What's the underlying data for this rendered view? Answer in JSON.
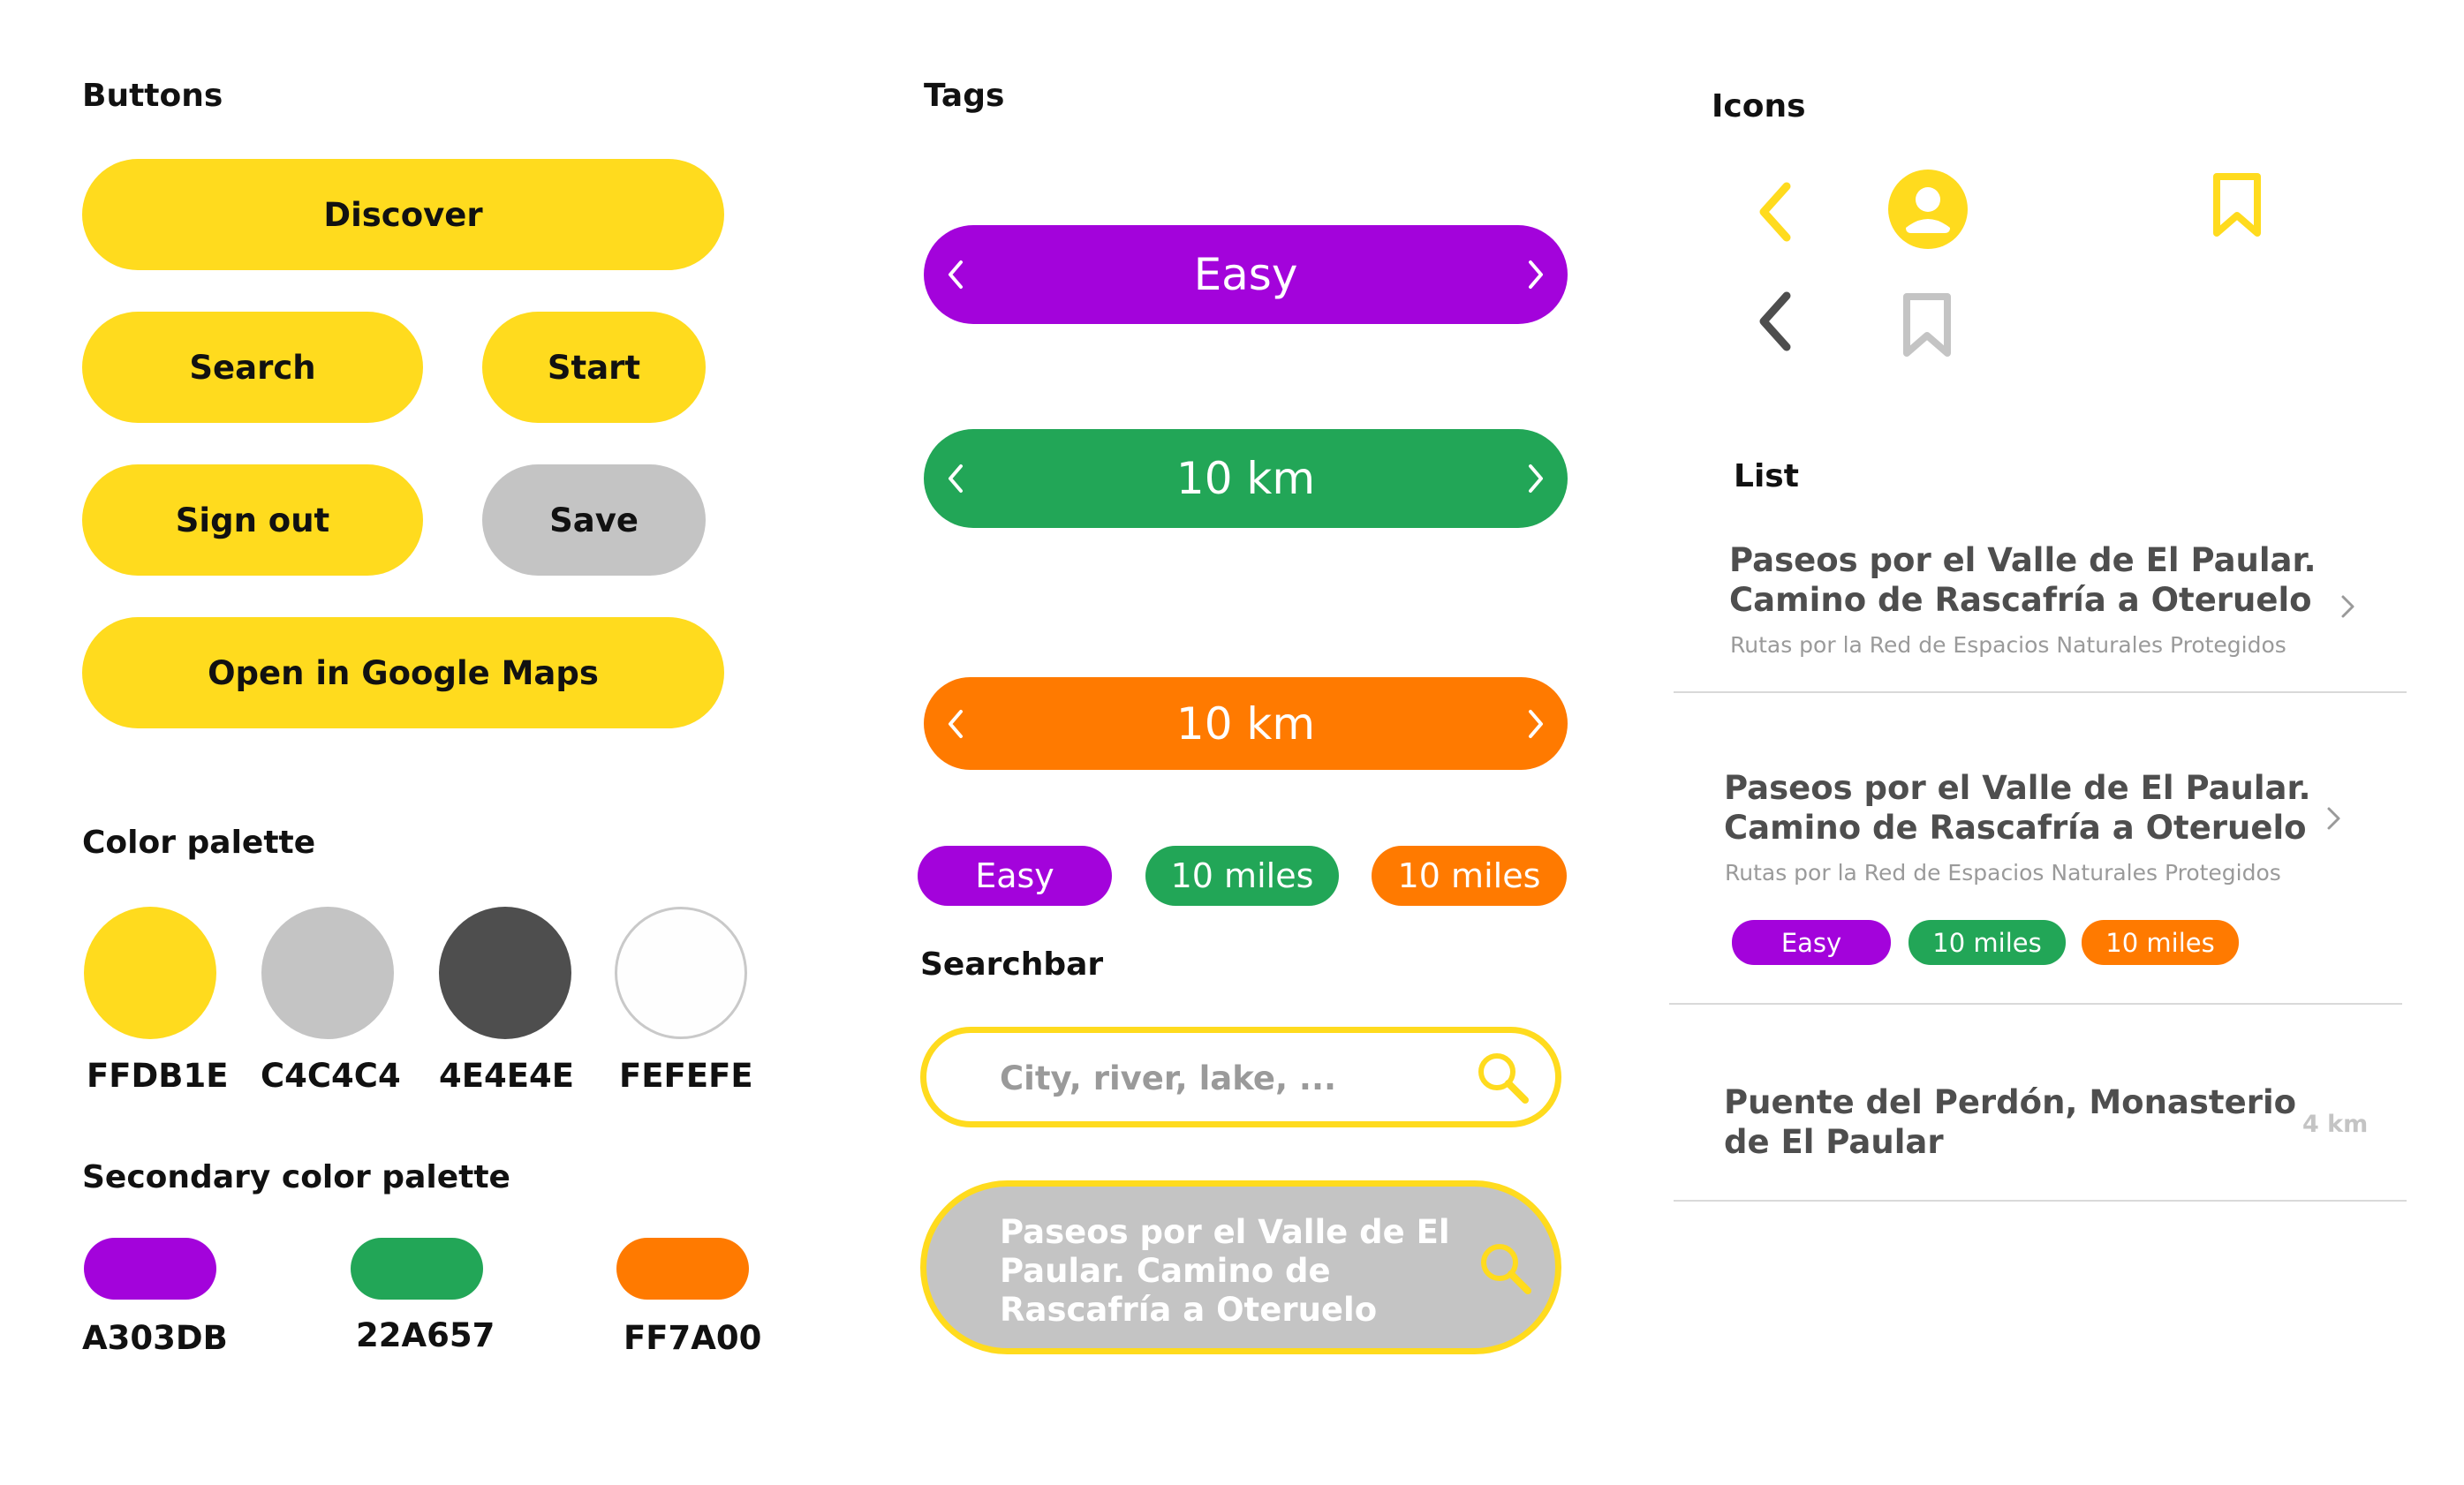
{
  "buttons": {
    "heading": "Buttons",
    "discover": "Discover",
    "search": "Search",
    "start": "Start",
    "sign_out": "Sign out",
    "save": "Save",
    "open_maps": "Open in Google Maps"
  },
  "palette": {
    "heading": "Color palette",
    "colors": [
      "FFDB1E",
      "C4C4C4",
      "4E4E4E",
      "FEFEFE"
    ]
  },
  "secondary_palette": {
    "heading": "Secondary color palette",
    "colors": [
      "A303DB",
      "22A657",
      "FF7A00"
    ]
  },
  "tags": {
    "heading": "Tags",
    "large": [
      "Easy",
      "10 km",
      "10 km"
    ],
    "small": [
      "Easy",
      "10 miles",
      "10 miles"
    ],
    "colors": {
      "purple": "#A303DB",
      "green": "#22A657",
      "orange": "#FF7A00"
    }
  },
  "searchbar": {
    "heading": "Searchbar",
    "placeholder": "City, river, lake, ...",
    "filled_line1": "Paseos por el Valle de El",
    "filled_line2": "Paular. Camino de",
    "filled_line3": "Rascafría a Oteruelo",
    "icon": "search-icon"
  },
  "icons": {
    "heading": "Icons",
    "items": [
      "chevron-left-icon",
      "user-circle-icon",
      "bookmark-icon",
      "chevron-left-icon",
      "bookmark-outline-icon"
    ]
  },
  "list": {
    "heading": "List",
    "items": [
      {
        "title1": "Paseos por el Valle de El Paular.",
        "title2": "Camino de Rascafría a Oteruelo",
        "subtitle": "Rutas por la Red de Espacios Naturales Protegidos"
      },
      {
        "title1": "Paseos por el Valle de El Paular.",
        "title2": "Camino de Rascafría a Oteruelo",
        "subtitle": "Rutas por la Red de Espacios Naturales Protegidos",
        "tags": [
          "Easy",
          "10 miles",
          "10 miles"
        ]
      },
      {
        "title1": "Puente del Perdón, Monasterio",
        "title2": "de El Paular",
        "distance": "4 km"
      }
    ]
  }
}
